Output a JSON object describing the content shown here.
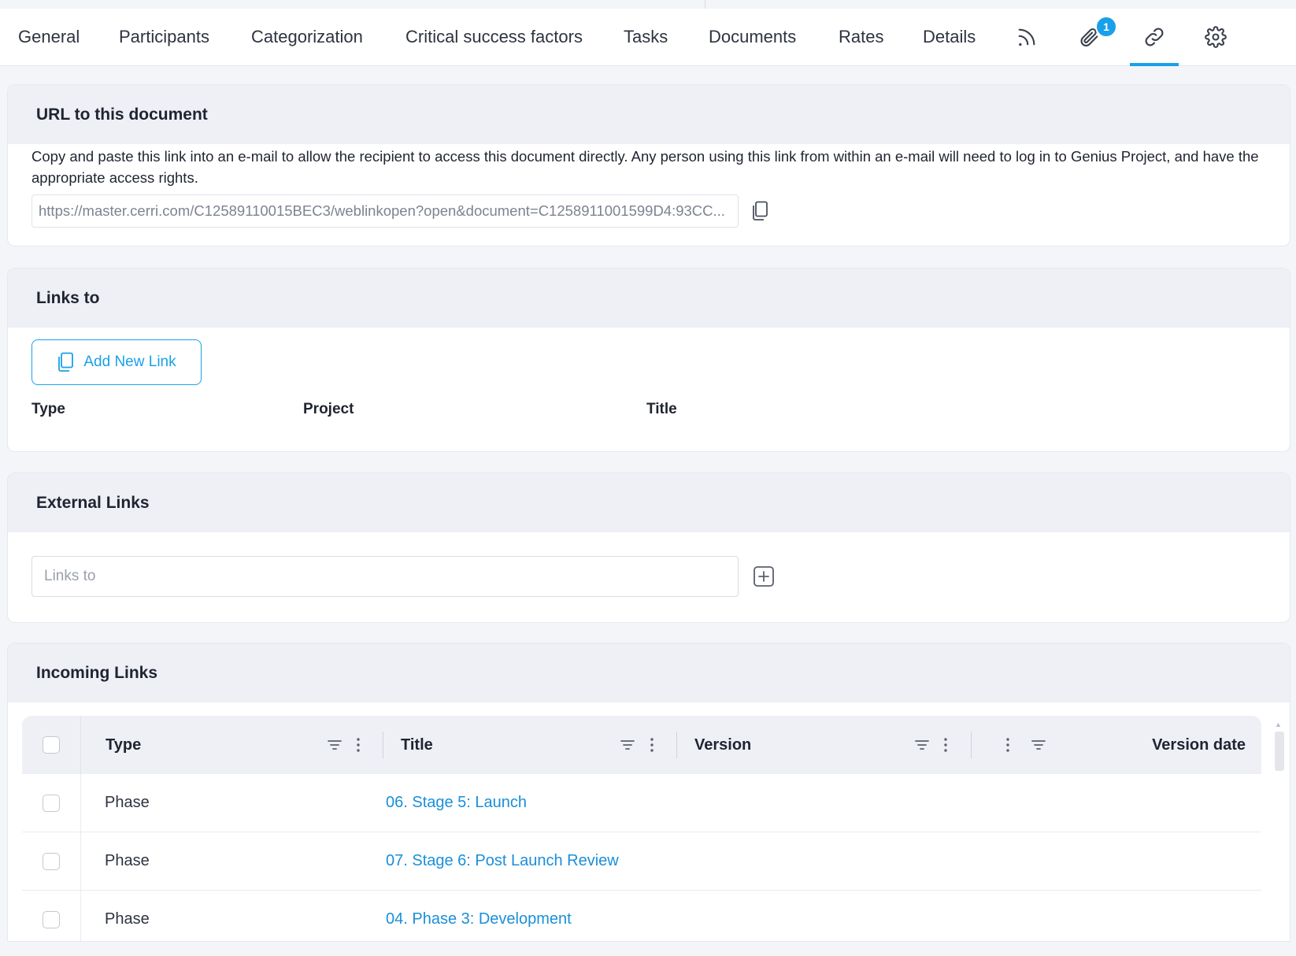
{
  "tabs": {
    "items": [
      "General",
      "Participants",
      "Categorization",
      "Critical success factors",
      "Tasks",
      "Documents",
      "Rates",
      "Details"
    ],
    "attachments_badge": "1"
  },
  "url_section": {
    "title": "URL to this document",
    "description": "Copy and paste this link into an e-mail to allow the recipient to access this document directly. Any person using this link from within an e-mail will need to log in to Genius Project, and have the appropriate access rights.",
    "url": "https://master.cerri.com/C12589110015BEC3/weblinkopen?open&document=C1258911001599D4:93CC..."
  },
  "links_to": {
    "title": "Links to",
    "add_button": "Add New Link",
    "columns": [
      "Type",
      "Project",
      "Title"
    ]
  },
  "external_links": {
    "title": "External Links",
    "placeholder": "Links to"
  },
  "incoming_links": {
    "title": "Incoming Links",
    "columns": {
      "type": "Type",
      "title": "Title",
      "version": "Version",
      "version_date": "Version date"
    },
    "rows": [
      {
        "type": "Phase",
        "title": "06. Stage 5: Launch"
      },
      {
        "type": "Phase",
        "title": "07. Stage 6: Post Launch Review"
      },
      {
        "type": "Phase",
        "title": "04. Phase 3: Development"
      }
    ]
  },
  "colors": {
    "accent": "#1aa0e8",
    "link": "#1a8fd9",
    "section_header_bg": "#eef0f6"
  }
}
